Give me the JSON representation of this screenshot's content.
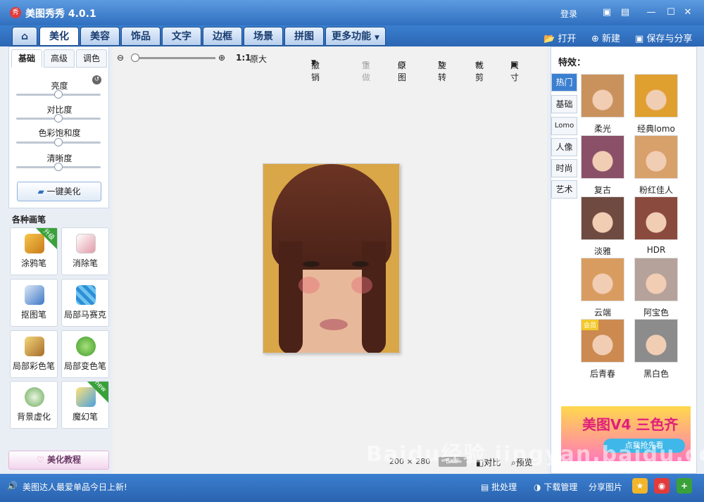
{
  "app": {
    "title": "美图秀秀 4.0.1",
    "login": "登录"
  },
  "tabs": [
    {
      "label": "美化",
      "active": true
    },
    {
      "label": "美容"
    },
    {
      "label": "饰品"
    },
    {
      "label": "文字"
    },
    {
      "label": "边框"
    },
    {
      "label": "场景"
    },
    {
      "label": "拼图"
    },
    {
      "label": "更多功能"
    }
  ],
  "file_actions": {
    "open": "打开",
    "new": "新建",
    "save_share": "保存与分享"
  },
  "adjust": {
    "tabs": [
      "基础",
      "高级",
      "调色"
    ],
    "sliders": [
      {
        "label": "亮度",
        "value": 0.5
      },
      {
        "label": "对比度",
        "value": 0.5
      },
      {
        "label": "色彩饱和度",
        "value": 0.5
      },
      {
        "label": "清晰度",
        "value": 0.5
      }
    ],
    "one_click": "一键美化"
  },
  "brushes": {
    "title": "各种画笔",
    "items": [
      {
        "label": "涂鸦笔",
        "badge": "升级"
      },
      {
        "label": "消除笔"
      },
      {
        "label": "抠图笔"
      },
      {
        "label": "局部马赛克"
      },
      {
        "label": "局部彩色笔"
      },
      {
        "label": "局部变色笔"
      },
      {
        "label": "背景虚化"
      },
      {
        "label": "魔幻笔",
        "badge": "new"
      }
    ]
  },
  "tutorial": "美化教程",
  "canvas_toolbar": {
    "zoom_actual": "1:1",
    "original_size": "原大",
    "undo": "撤销",
    "redo": "重做",
    "original": "原图",
    "rotate": "旋转",
    "crop": "裁剪",
    "resize": "尺寸"
  },
  "image_info": {
    "width": "200",
    "x": "×",
    "height": "280",
    "exif": "EXIF",
    "compare": "对比",
    "preview": "预览"
  },
  "effects": {
    "title": "特效：",
    "categories": [
      "热门",
      "基础",
      "Lomo",
      "人像",
      "时尚",
      "艺术"
    ],
    "items": [
      {
        "label": "柔光",
        "tint": "#c9925c"
      },
      {
        "label": "经典lomo",
        "tint": "#e0a030"
      },
      {
        "label": "复古",
        "tint": "#8a5068"
      },
      {
        "label": "粉红佳人",
        "tint": "#d8a06a"
      },
      {
        "label": "淡雅",
        "tint": "#6e4a40"
      },
      {
        "label": "HDR",
        "tint": "#8a4a3e"
      },
      {
        "label": "云端",
        "tint": "#d99c60"
      },
      {
        "label": "阿宝色",
        "tint": "#b5a29a"
      },
      {
        "label": "后青春",
        "tint": "#cc8a50",
        "badge": "会员"
      },
      {
        "label": "黑白色",
        "tint": "#8c8c8c"
      }
    ]
  },
  "ad": {
    "line1": "美图V4 三色齐",
    "line2": "点我抢先看"
  },
  "status": {
    "message": "美图达人最爱单品今日上新!",
    "batch": "批处理",
    "download": "下载管理",
    "share": "分享图片"
  },
  "watermark": "Baidu经验 jingyan.baidu.com"
}
